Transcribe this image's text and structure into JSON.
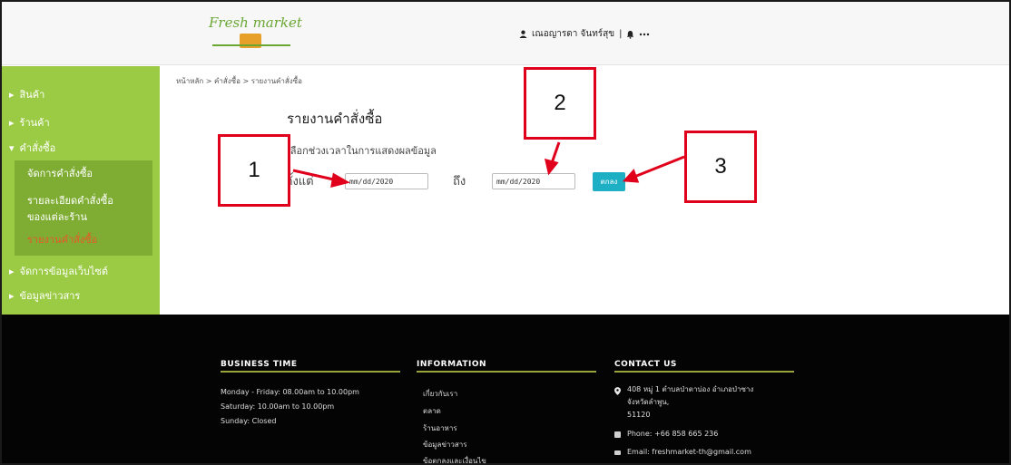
{
  "header": {
    "logo_text": "Fresh market",
    "user_name": "เณอญารดา จันทร์สุข",
    "separator": "|",
    "icons": [
      "user-icon",
      "bell-icon",
      "more-icon"
    ]
  },
  "sidebar": {
    "items": [
      {
        "label": "สินค้า"
      },
      {
        "label": "ร้านค้า"
      },
      {
        "label": "คำสั่งซื้อ"
      },
      {
        "label": "จัดการข้อมูลเว็บไซต์"
      },
      {
        "label": "ข้อมูลข่าวสาร"
      }
    ],
    "sub_items": [
      {
        "label": "จัดการคำสั่งซื้อ"
      },
      {
        "label": "รายละเอียดคำสั่งซื้อ"
      },
      {
        "label": "ของแต่ละร้าน"
      },
      {
        "label": "รายงานคำสั่งซื้อ"
      }
    ]
  },
  "main": {
    "breadcrumb": "หน้าหลัก > คำสั่งซื้อ > รายงานคำสั่งซื้อ",
    "title": "รายงานคำสั่งซื้อ",
    "select_label": "เลือกช่วงเวลาในการแสดงผลข้อมูล",
    "from_label": "ตั้งแต่",
    "to_label": "ถึง",
    "from_value": "mm/dd/2020",
    "to_value": "mm/dd/2020",
    "submit_label": "ตกลง"
  },
  "callouts": [
    "1",
    "2",
    "3"
  ],
  "accent_colors": {
    "sidebar": "#9bcb45",
    "sidebar_sub": "#7fad33",
    "button": "#1db0c4",
    "callout": "#e0001b",
    "active": "#e6592a"
  },
  "footer": {
    "business": {
      "heading": "BUSINESS TIME",
      "lines": [
        "Monday - Friday: 08.00am to 10.00pm",
        "Saturday: 10.00am to 10.00pm",
        "Sunday: Closed"
      ]
    },
    "info": {
      "heading": "INFORMATION",
      "links": [
        "เกี่ยวกับเรา",
        "ตลาด",
        "ร้านอาหาร",
        "ข้อมูลข่าวสาร",
        "ข้อตกลงและเงื่อนไข"
      ]
    },
    "contact": {
      "heading": "CONTACT US",
      "address": [
        "408 หมู่ 1 ตำบลป่าตาบ่อง อำเภอป่าซาง",
        "จังหวัดลำพูน,",
        "51120"
      ],
      "phone": "Phone: +66 858 665 236",
      "email": "Email: freshmarket-th@gmail.com"
    }
  }
}
